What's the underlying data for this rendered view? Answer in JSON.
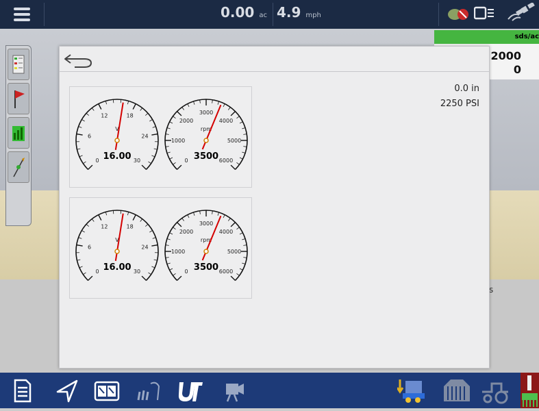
{
  "topbar": {
    "area_value": "0.00",
    "area_unit": "ac",
    "speed_value": "4.9",
    "speed_unit": "mph"
  },
  "right_widget": {
    "header": "sds/ac",
    "value1": "2000",
    "value2": "0"
  },
  "background_hint": "s",
  "readouts": {
    "depth": "0.0 in",
    "pressure": "2250 PSI"
  },
  "gauge_panels": [
    {
      "voltage": {
        "value": "16.00",
        "unit": "V",
        "min": 0,
        "max": 30,
        "level": 16.0,
        "ticks": [
          "0",
          "6",
          "12",
          "18",
          "24",
          "30"
        ]
      },
      "rpm": {
        "value": "3500",
        "unit": "rpm",
        "min": 0,
        "max": 6000,
        "level": 3500,
        "ticks": [
          "0",
          "1000",
          "2000",
          "3000",
          "4000",
          "5000",
          "6000"
        ]
      }
    },
    {
      "voltage": {
        "value": "16.00",
        "unit": "V",
        "min": 0,
        "max": 30,
        "level": 16.0,
        "ticks": [
          "0",
          "6",
          "12",
          "18",
          "24",
          "30"
        ]
      },
      "rpm": {
        "value": "3500",
        "unit": "rpm",
        "min": 0,
        "max": 6000,
        "level": 3500,
        "ticks": [
          "0",
          "1000",
          "2000",
          "3000",
          "4000",
          "5000",
          "6000"
        ]
      }
    }
  ],
  "icons": {
    "menu": "hamburger-menu-icon",
    "back": "back-arrow-icon",
    "bottom": [
      "report-icon",
      "navigation-arrow-icon",
      "split-view-icon",
      "planting-icon",
      "universal-terminal-icon",
      "camera-icon",
      "implement-icon",
      "grain-bin-icon",
      "tractor-icon",
      "machine-status-icon"
    ]
  },
  "colors": {
    "topbar": "#1b2a44",
    "bottombar": "#1d3a78",
    "needle": "#d40000",
    "accent_green": "#45b540"
  }
}
